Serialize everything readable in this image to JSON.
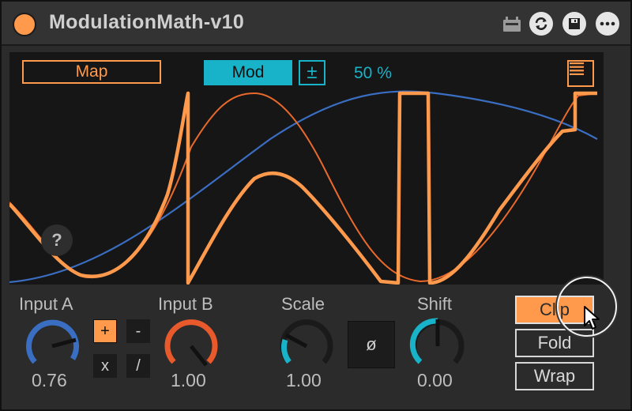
{
  "device": {
    "title": "ModulationMath-v10",
    "colors": {
      "accent_orange": "#ff9a4d",
      "accent_cyan": "#18b3c8",
      "wave_blue": "#3a6ec2",
      "background": "#2b2b2b"
    },
    "title_icons": [
      "clip-icon",
      "hot-swap-icon",
      "save-icon",
      "more-icon"
    ]
  },
  "display": {
    "map_label": "Map",
    "mod_label": "Mod",
    "plus_minus_label": "±",
    "mod_amount_text": "50 %",
    "help_label": "?",
    "menu_icon": "menu-icon"
  },
  "controls": {
    "input_a": {
      "label": "Input A",
      "value": "0.76",
      "normalized": 0.76
    },
    "input_b": {
      "label": "Input B",
      "value": "1.00",
      "normalized": 1.0
    },
    "scale": {
      "label": "Scale",
      "value": "1.00",
      "normalized": 0.3
    },
    "shift": {
      "label": "Shift",
      "value": "0.00",
      "normalized": 0.5
    },
    "ops": {
      "add": "+",
      "sub": "-",
      "mul": "x",
      "div": "/",
      "selected": "+"
    },
    "phase_label": "ø",
    "modes": {
      "clip": "Clip",
      "fold": "Fold",
      "wrap": "Wrap",
      "selected": "Clip"
    }
  }
}
